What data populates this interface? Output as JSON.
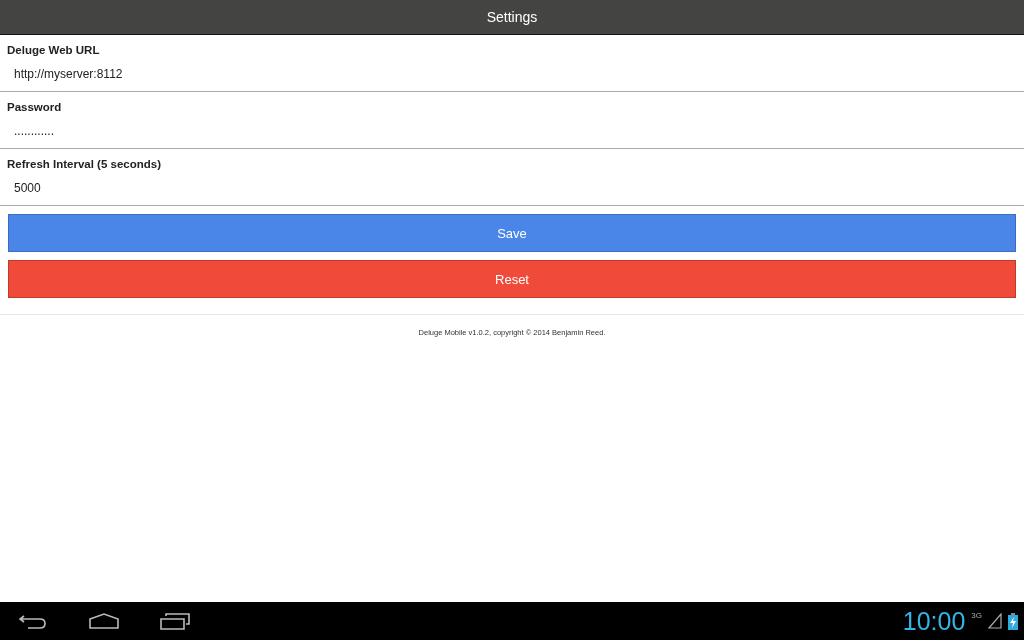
{
  "title_bar": {
    "title": "Settings"
  },
  "fields": [
    {
      "label": "Deluge Web URL",
      "value": "http://myserver:8112"
    },
    {
      "label": "Password",
      "value": "............"
    },
    {
      "label": "Refresh Interval (5 seconds)",
      "value": "5000"
    }
  ],
  "buttons": [
    {
      "label": "Save",
      "kind": "primary"
    },
    {
      "label": "Reset",
      "kind": "danger"
    }
  ],
  "footer": "Deluge Mobile v1.0.2, copyright © 2014 Benjamin Reed.",
  "system_bar": {
    "time": "10:00",
    "network": "3G"
  }
}
